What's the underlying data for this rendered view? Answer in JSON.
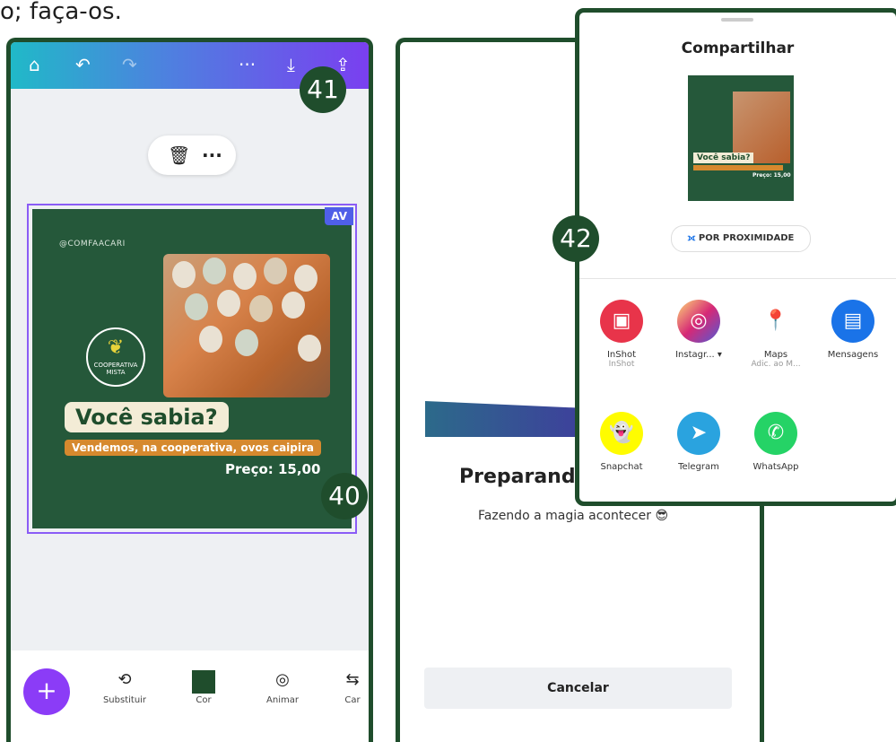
{
  "caption": "o; faça-os.",
  "editor": {
    "topbar_icons": [
      "home-icon",
      "undo-icon",
      "redo-icon",
      "more-icon",
      "download-icon",
      "share-icon"
    ],
    "toolbar_pill": {
      "delete_icon": "🗑",
      "more": "···"
    },
    "design": {
      "badge": "AV",
      "handle": "@COMFAACARI",
      "logo_text": "COOPERATIVA MISTA",
      "title": "Você sabia?",
      "subtitle": "Vendemos, na cooperativa, ovos caipira",
      "price": "Preço: 15,00"
    },
    "bottom_tools": [
      {
        "label": "Substituir",
        "icon": "⟲"
      },
      {
        "label": "Cor",
        "icon": ""
      },
      {
        "label": "Animar",
        "icon": "◎"
      },
      {
        "label": "Car",
        "icon": "⇆"
      }
    ],
    "fab": "+"
  },
  "preparing": {
    "title": "Preparando",
    "subtitle": "Fazendo a magia acontecer 😎",
    "cancel": "Cancelar"
  },
  "share_sheet": {
    "title": "Compartilhar",
    "thumb_title": "Você sabia?",
    "thumb_price": "Preço: 15,00",
    "proximity": "POR PROXIMIDADE",
    "apps": [
      {
        "name": "InShot",
        "sub": "InShot",
        "color": "#e8344a",
        "glyph": "▣"
      },
      {
        "name": "Instagr...",
        "sub": "",
        "color": "#d6249f",
        "glyph": "◎"
      },
      {
        "name": "Maps",
        "sub": "Adic. ao M...",
        "color": "#ffffff",
        "glyph": "📍"
      },
      {
        "name": "Mensagens",
        "sub": "",
        "color": "#1a73e8",
        "glyph": "▤"
      },
      {
        "name": "Snapchat",
        "sub": "",
        "color": "#fffc00",
        "glyph": "👻"
      },
      {
        "name": "Telegram",
        "sub": "",
        "color": "#2aa3df",
        "glyph": "➤"
      },
      {
        "name": "WhatsApp",
        "sub": "",
        "color": "#25d366",
        "glyph": "✆"
      }
    ]
  },
  "badges": {
    "b40": "40",
    "b41": "41",
    "b42": "42"
  }
}
